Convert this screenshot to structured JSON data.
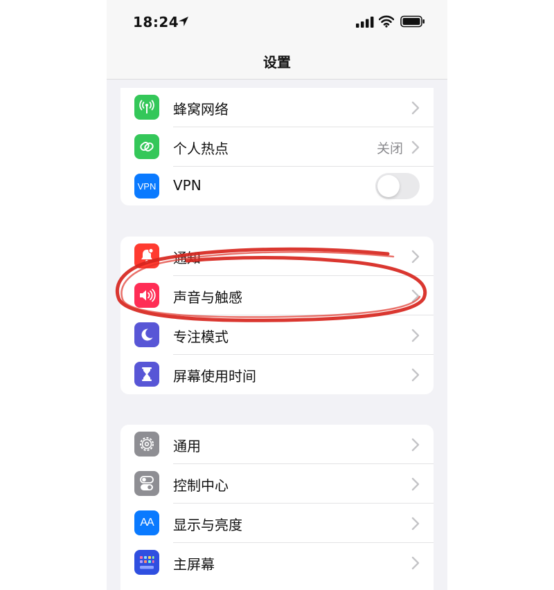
{
  "status_bar": {
    "time": "18:24",
    "location_icon": "location-arrow-icon",
    "signal_icon": "cellular-signal-icon",
    "wifi_icon": "wifi-icon",
    "battery_icon": "battery-icon"
  },
  "nav": {
    "title": "设置"
  },
  "groups": [
    {
      "items": [
        {
          "label": "蜂窝网络",
          "icon": "antenna-icon",
          "color": "#34c759",
          "accessory": "chevron"
        },
        {
          "label": "个人热点",
          "icon": "hotspot-link-icon",
          "color": "#34c759",
          "value": "关闭",
          "accessory": "chevron"
        },
        {
          "label": "VPN",
          "icon": "vpn-icon",
          "icon_text": "VPN",
          "color": "#0a7aff",
          "accessory": "toggle",
          "toggle_on": false
        }
      ]
    },
    {
      "items": [
        {
          "label": "通知",
          "icon": "bell-icon",
          "color": "#ff3b30",
          "accessory": "chevron"
        },
        {
          "label": "声音与触感",
          "icon": "speaker-icon",
          "color": "#ff2d55",
          "accessory": "chevron"
        },
        {
          "label": "专注模式",
          "icon": "moon-icon",
          "color": "#5856d6",
          "accessory": "chevron"
        },
        {
          "label": "屏幕使用时间",
          "icon": "hourglass-icon",
          "color": "#5856d6",
          "accessory": "chevron"
        }
      ]
    },
    {
      "items": [
        {
          "label": "通用",
          "icon": "gear-icon",
          "color": "#8e8e93",
          "accessory": "chevron"
        },
        {
          "label": "控制中心",
          "icon": "switches-icon",
          "color": "#8e8e93",
          "accessory": "chevron"
        },
        {
          "label": "显示与亮度",
          "icon": "text-size-icon",
          "icon_text": "AA",
          "color": "#0a7aff",
          "accessory": "chevron"
        },
        {
          "label": "主屏幕",
          "icon": "app-grid-icon",
          "color": "#2f4fe0",
          "accessory": "chevron"
        }
      ]
    }
  ],
  "annotation": {
    "type": "hand-drawn-circle",
    "color": "#d7261e",
    "target": "声音与触感"
  }
}
